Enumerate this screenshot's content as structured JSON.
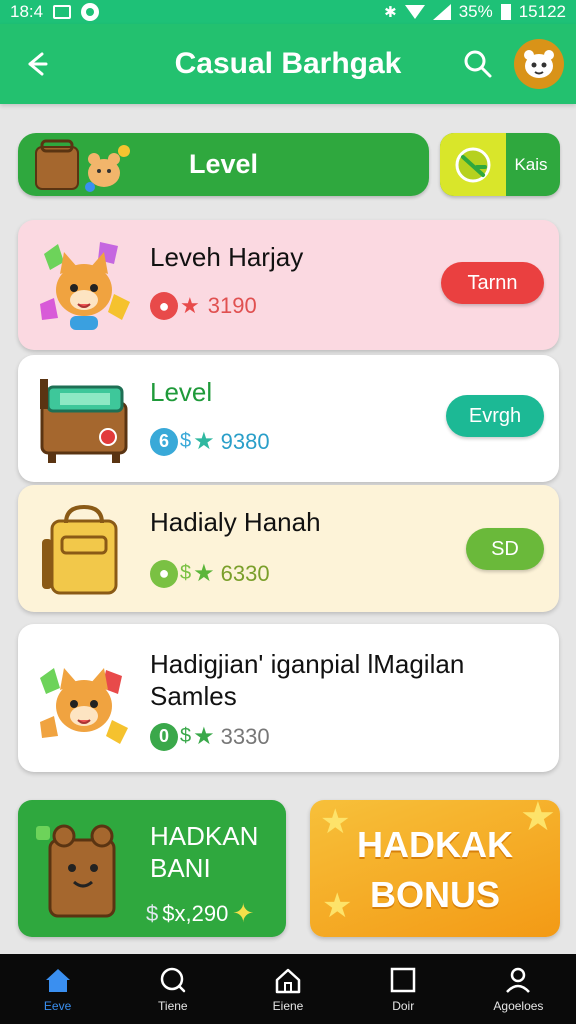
{
  "status_bar": {
    "time": "18:4",
    "battery": "35%",
    "clock": "15122"
  },
  "app_bar": {
    "title": "Casual Barhgak"
  },
  "level_bar": {
    "label": "Level",
    "side_button": "Kais"
  },
  "cards": [
    {
      "title": "Leveh Harjay",
      "stat": "3190",
      "button": "Tarnn",
      "bg": "#fbd9e1",
      "button_color": "#ea4040",
      "title_color": "#111111"
    },
    {
      "title": "Level",
      "stat": "9380",
      "button": "Evrgh",
      "bg": "#ffffff",
      "button_color": "#1cb995",
      "title_color": "#1f9a3a"
    },
    {
      "title": "Hadialy Hanah",
      "stat": "6330",
      "button": "SD",
      "bg": "#fdf3d8",
      "button_color": "#6ab93a",
      "title_color": "#111111"
    },
    {
      "title_line1": "Hadigjian' iganpial lMagilan",
      "title_line2": "Samles",
      "stat": "3330",
      "bg": "#ffffff"
    }
  ],
  "promos": [
    {
      "title_line1": "HADKAN",
      "title_line2": "BANI",
      "price": "$x,290"
    },
    {
      "title_line1": "HADKAK",
      "title_line2": "BONUS"
    }
  ],
  "nav": [
    {
      "label": "Eeve",
      "icon": "home-icon",
      "active": true
    },
    {
      "label": "Tiene",
      "icon": "search-icon"
    },
    {
      "label": "Eiene",
      "icon": "house-icon"
    },
    {
      "label": "Doir",
      "icon": "square-icon"
    },
    {
      "label": "Agoeloes",
      "icon": "profile-icon"
    }
  ],
  "colors": {
    "primary_green": "#23c16f",
    "accent_green": "#2fa83e",
    "orange": "#f39a15",
    "nav_active": "#3a8ff0"
  }
}
